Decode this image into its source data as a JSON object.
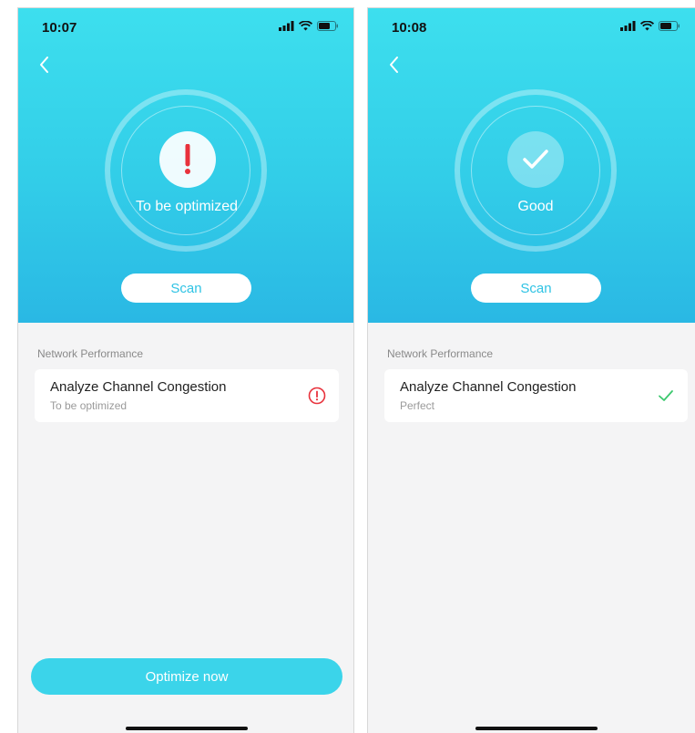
{
  "screens": [
    {
      "time": "10:07",
      "status_text": "To be optimized",
      "status_icon": "exclamation-icon",
      "scan_label": "Scan",
      "section_title": "Network Performance",
      "item": {
        "title": "Analyze Channel Congestion",
        "subtitle": "To be optimized",
        "icon": "warning-circle-icon"
      },
      "optimize_label": "Optimize now"
    },
    {
      "time": "10:08",
      "status_text": "Good",
      "status_icon": "checkmark-icon",
      "scan_label": "Scan",
      "section_title": "Network Performance",
      "item": {
        "title": "Analyze Channel Congestion",
        "subtitle": "Perfect",
        "icon": "check-icon"
      }
    }
  ],
  "colors": {
    "accent": "#3bd4ea",
    "warning": "#e8323c",
    "success": "#3cc86e"
  }
}
